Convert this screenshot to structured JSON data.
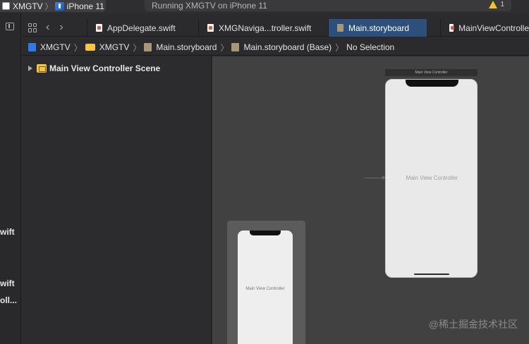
{
  "toolbar": {
    "scheme_project": "XMGTV",
    "scheme_device": "iPhone 11",
    "status_text": "Running XMGTV on iPhone 11",
    "warning_count": "1",
    "warning_color": "#f2c12e"
  },
  "navigator": {
    "fragments": [
      "wift",
      "wift",
      "oll..."
    ]
  },
  "tabs": [
    {
      "label": "AppDelegate.swift",
      "icon": "swift-file-icon"
    },
    {
      "label": "XMGNaviga...troller.swift",
      "icon": "swift-file-icon"
    },
    {
      "label": "Main.storyboard",
      "icon": "storyboard-file-icon",
      "active": true
    },
    {
      "label": "MainViewControlle",
      "icon": "swift-file-icon"
    }
  ],
  "jumpbar": {
    "items": [
      "XMGTV",
      "XMGTV",
      "Main.storyboard",
      "Main.storyboard (Base)",
      "No Selection"
    ]
  },
  "outline": {
    "scene_label": "Main View Controller Scene"
  },
  "canvas": {
    "main_vc_title": "Main View Controller",
    "main_vc_label": "Main View Controller",
    "mini_vc_label": "Main View Controller"
  },
  "watermark": "@稀土掘金技术社区",
  "colors": {
    "active_tab": "#2c4f7c",
    "canvas_bg": "#414141",
    "panel_bg": "#2c2c2e"
  }
}
